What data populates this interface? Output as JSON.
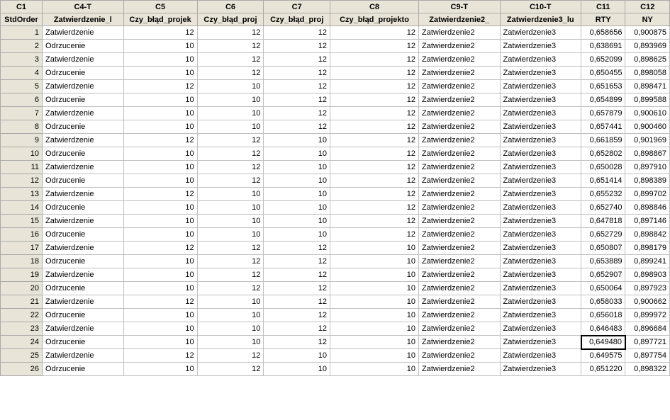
{
  "columns": {
    "header1": [
      "C1",
      "C4-T",
      "C5",
      "C6",
      "C7",
      "C8",
      "C9-T",
      "C10-T",
      "C11",
      "C12"
    ],
    "header2": [
      "StdOrder",
      "Zatwierdzenie_l",
      "Czy_błąd_projek",
      "Czy_błąd_proj",
      "Czy_błąd_proj",
      "Czy_błąd_projekto",
      "Zatwierdzenie2_",
      "Zatwierdzenie3_lu",
      "RTY",
      "NY"
    ]
  },
  "selected": {
    "row": 24,
    "col": 8
  },
  "rows": [
    {
      "n": 1,
      "c4": "Zatwierdzenie",
      "c5": 12,
      "c6": 12,
      "c7": 12,
      "c8": 12,
      "c9": "Zatwierdzenie2",
      "c10": "Zatwierdzenie3",
      "c11": "0,658656",
      "c12": "0,900875"
    },
    {
      "n": 2,
      "c4": "Odrzucenie",
      "c5": 10,
      "c6": 12,
      "c7": 12,
      "c8": 12,
      "c9": "Zatwierdzenie2",
      "c10": "Zatwierdzenie3",
      "c11": "0,638691",
      "c12": "0,893969"
    },
    {
      "n": 3,
      "c4": "Zatwierdzenie",
      "c5": 10,
      "c6": 12,
      "c7": 12,
      "c8": 12,
      "c9": "Zatwierdzenie2",
      "c10": "Zatwierdzenie3",
      "c11": "0,652099",
      "c12": "0,898625"
    },
    {
      "n": 4,
      "c4": "Odrzucenie",
      "c5": 10,
      "c6": 12,
      "c7": 12,
      "c8": 12,
      "c9": "Zatwierdzenie2",
      "c10": "Zatwierdzenie3",
      "c11": "0,650455",
      "c12": "0,898058"
    },
    {
      "n": 5,
      "c4": "Zatwierdzenie",
      "c5": 12,
      "c6": 10,
      "c7": 12,
      "c8": 12,
      "c9": "Zatwierdzenie2",
      "c10": "Zatwierdzenie3",
      "c11": "0,651653",
      "c12": "0,898471"
    },
    {
      "n": 6,
      "c4": "Odrzucenie",
      "c5": 10,
      "c6": 10,
      "c7": 12,
      "c8": 12,
      "c9": "Zatwierdzenie2",
      "c10": "Zatwierdzenie3",
      "c11": "0,654899",
      "c12": "0,899588"
    },
    {
      "n": 7,
      "c4": "Zatwierdzenie",
      "c5": 10,
      "c6": 10,
      "c7": 12,
      "c8": 12,
      "c9": "Zatwierdzenie2",
      "c10": "Zatwierdzenie3",
      "c11": "0,657879",
      "c12": "0,900610"
    },
    {
      "n": 8,
      "c4": "Odrzucenie",
      "c5": 10,
      "c6": 10,
      "c7": 12,
      "c8": 12,
      "c9": "Zatwierdzenie2",
      "c10": "Zatwierdzenie3",
      "c11": "0,657441",
      "c12": "0,900460"
    },
    {
      "n": 9,
      "c4": "Zatwierdzenie",
      "c5": 12,
      "c6": 12,
      "c7": 10,
      "c8": 12,
      "c9": "Zatwierdzenie2",
      "c10": "Zatwierdzenie3",
      "c11": "0,661859",
      "c12": "0,901969"
    },
    {
      "n": 10,
      "c4": "Odrzucenie",
      "c5": 10,
      "c6": 12,
      "c7": 10,
      "c8": 12,
      "c9": "Zatwierdzenie2",
      "c10": "Zatwierdzenie3",
      "c11": "0,652802",
      "c12": "0,898867"
    },
    {
      "n": 11,
      "c4": "Zatwierdzenie",
      "c5": 10,
      "c6": 12,
      "c7": 10,
      "c8": 12,
      "c9": "Zatwierdzenie2",
      "c10": "Zatwierdzenie3",
      "c11": "0,650028",
      "c12": "0,897910"
    },
    {
      "n": 12,
      "c4": "Odrzucenie",
      "c5": 10,
      "c6": 12,
      "c7": 10,
      "c8": 12,
      "c9": "Zatwierdzenie2",
      "c10": "Zatwierdzenie3",
      "c11": "0,651414",
      "c12": "0,898389"
    },
    {
      "n": 13,
      "c4": "Zatwierdzenie",
      "c5": 12,
      "c6": 10,
      "c7": 10,
      "c8": 12,
      "c9": "Zatwierdzenie2",
      "c10": "Zatwierdzenie3",
      "c11": "0,655232",
      "c12": "0,899702"
    },
    {
      "n": 14,
      "c4": "Odrzucenie",
      "c5": 10,
      "c6": 10,
      "c7": 10,
      "c8": 12,
      "c9": "Zatwierdzenie2",
      "c10": "Zatwierdzenie3",
      "c11": "0,652740",
      "c12": "0,898846"
    },
    {
      "n": 15,
      "c4": "Zatwierdzenie",
      "c5": 10,
      "c6": 10,
      "c7": 10,
      "c8": 12,
      "c9": "Zatwierdzenie2",
      "c10": "Zatwierdzenie3",
      "c11": "0,647818",
      "c12": "0,897146"
    },
    {
      "n": 16,
      "c4": "Odrzucenie",
      "c5": 10,
      "c6": 10,
      "c7": 10,
      "c8": 12,
      "c9": "Zatwierdzenie2",
      "c10": "Zatwierdzenie3",
      "c11": "0,652729",
      "c12": "0,898842"
    },
    {
      "n": 17,
      "c4": "Zatwierdzenie",
      "c5": 12,
      "c6": 12,
      "c7": 12,
      "c8": 10,
      "c9": "Zatwierdzenie2",
      "c10": "Zatwierdzenie3",
      "c11": "0,650807",
      "c12": "0,898179"
    },
    {
      "n": 18,
      "c4": "Odrzucenie",
      "c5": 10,
      "c6": 12,
      "c7": 12,
      "c8": 10,
      "c9": "Zatwierdzenie2",
      "c10": "Zatwierdzenie3",
      "c11": "0,653889",
      "c12": "0,899241"
    },
    {
      "n": 19,
      "c4": "Zatwierdzenie",
      "c5": 10,
      "c6": 12,
      "c7": 12,
      "c8": 10,
      "c9": "Zatwierdzenie2",
      "c10": "Zatwierdzenie3",
      "c11": "0,652907",
      "c12": "0,898903"
    },
    {
      "n": 20,
      "c4": "Odrzucenie",
      "c5": 10,
      "c6": 12,
      "c7": 12,
      "c8": 10,
      "c9": "Zatwierdzenie2",
      "c10": "Zatwierdzenie3",
      "c11": "0,650064",
      "c12": "0,897923"
    },
    {
      "n": 21,
      "c4": "Zatwierdzenie",
      "c5": 12,
      "c6": 10,
      "c7": 12,
      "c8": 10,
      "c9": "Zatwierdzenie2",
      "c10": "Zatwierdzenie3",
      "c11": "0,658033",
      "c12": "0,900662"
    },
    {
      "n": 22,
      "c4": "Odrzucenie",
      "c5": 10,
      "c6": 10,
      "c7": 12,
      "c8": 10,
      "c9": "Zatwierdzenie2",
      "c10": "Zatwierdzenie3",
      "c11": "0,656018",
      "c12": "0,899972"
    },
    {
      "n": 23,
      "c4": "Zatwierdzenie",
      "c5": 10,
      "c6": 10,
      "c7": 12,
      "c8": 10,
      "c9": "Zatwierdzenie2",
      "c10": "Zatwierdzenie3",
      "c11": "0,646483",
      "c12": "0,896684"
    },
    {
      "n": 24,
      "c4": "Odrzucenie",
      "c5": 10,
      "c6": 10,
      "c7": 12,
      "c8": 10,
      "c9": "Zatwierdzenie2",
      "c10": "Zatwierdzenie3",
      "c11": "0,649480",
      "c12": "0,897721"
    },
    {
      "n": 25,
      "c4": "Zatwierdzenie",
      "c5": 12,
      "c6": 12,
      "c7": 10,
      "c8": 10,
      "c9": "Zatwierdzenie2",
      "c10": "Zatwierdzenie3",
      "c11": "0,649575",
      "c12": "0,897754"
    },
    {
      "n": 26,
      "c4": "Odrzucenie",
      "c5": 10,
      "c6": 12,
      "c7": 10,
      "c8": 10,
      "c9": "Zatwierdzenie2",
      "c10": "Zatwierdzenie3",
      "c11": "0,651220",
      "c12": "0,898322"
    }
  ]
}
